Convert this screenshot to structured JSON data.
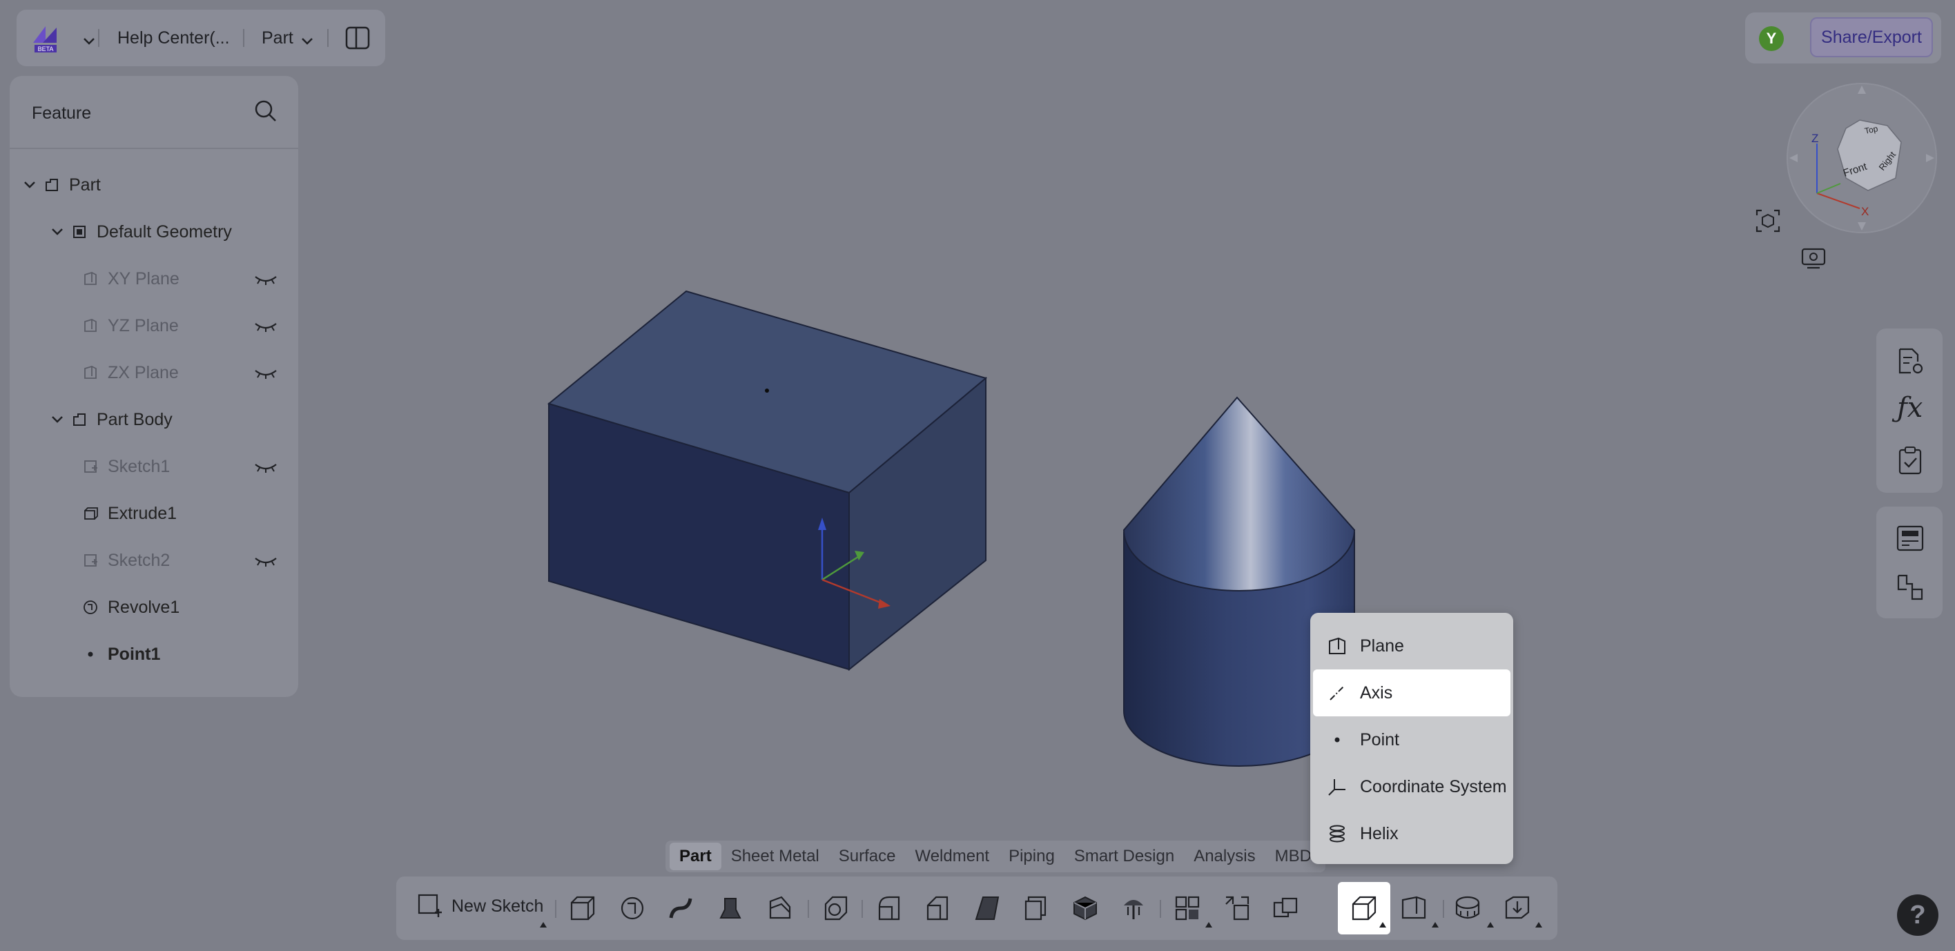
{
  "app": {
    "doc_title": "Help Center(...",
    "mode_label": "Part",
    "share_label": "Share/Export",
    "avatar_initial": "Y",
    "logo_badge": "BETA"
  },
  "feature_panel": {
    "title": "Feature",
    "tree": [
      {
        "label": "Part",
        "level": 0,
        "expanded": true,
        "icon": "part-icon"
      },
      {
        "label": "Default Geometry",
        "level": 1,
        "expanded": true,
        "icon": "geometry-icon"
      },
      {
        "label": "XY Plane",
        "level": 2,
        "hidden": true,
        "icon": "plane-icon"
      },
      {
        "label": "YZ Plane",
        "level": 2,
        "hidden": true,
        "icon": "plane-icon"
      },
      {
        "label": "ZX Plane",
        "level": 2,
        "hidden": true,
        "icon": "plane-icon"
      },
      {
        "label": "Part Body",
        "level": 1,
        "expanded": true,
        "icon": "part-icon"
      },
      {
        "label": "Sketch1",
        "level": 2,
        "hidden": true,
        "icon": "sketch-icon"
      },
      {
        "label": "Extrude1",
        "level": 2,
        "hidden": false,
        "icon": "extrude-icon"
      },
      {
        "label": "Sketch2",
        "level": 2,
        "hidden": true,
        "icon": "sketch-icon"
      },
      {
        "label": "Revolve1",
        "level": 2,
        "hidden": false,
        "icon": "revolve-icon"
      },
      {
        "label": "Point1",
        "level": 2,
        "hidden": false,
        "icon": "point-icon"
      }
    ]
  },
  "viewcube": {
    "faces": [
      "Top",
      "Front",
      "Right"
    ],
    "axes": [
      "Z",
      "X"
    ]
  },
  "tabs": [
    "Part",
    "Sheet Metal",
    "Surface",
    "Weldment",
    "Piping",
    "Smart Design",
    "Analysis",
    "MBD"
  ],
  "active_tab": "Part",
  "toolbar": {
    "new_sketch_label": "New Sketch"
  },
  "dropdown": {
    "items": [
      {
        "label": "Plane",
        "icon": "plane-icon"
      },
      {
        "label": "Axis",
        "icon": "axis-icon"
      },
      {
        "label": "Point",
        "icon": "point-icon"
      },
      {
        "label": "Coordinate System",
        "icon": "coordinate-system-icon"
      },
      {
        "label": "Helix",
        "icon": "helix-icon"
      }
    ],
    "highlighted": "Axis"
  },
  "help_label": "?",
  "colors": {
    "viewport_bg": "#7d7f89",
    "model_fill": "#2c3b66",
    "share_text": "#332c80",
    "avatar_bg": "#4a8a2e"
  }
}
